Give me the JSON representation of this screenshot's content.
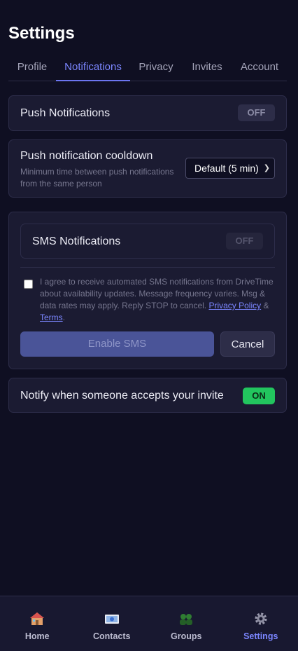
{
  "page": {
    "title": "Settings"
  },
  "tabs": [
    {
      "label": "Profile",
      "active": false
    },
    {
      "label": "Notifications",
      "active": true
    },
    {
      "label": "Privacy",
      "active": false
    },
    {
      "label": "Invites",
      "active": false
    },
    {
      "label": "Account",
      "active": false
    }
  ],
  "push": {
    "label": "Push Notifications",
    "state": "OFF"
  },
  "cooldown": {
    "label": "Push notification cooldown",
    "description_line1": "Minimum time between push notifications",
    "description_line2": "from the same person",
    "selected": "Default (5 min)"
  },
  "sms": {
    "label": "SMS Notifications",
    "state": "OFF",
    "consent_line1": "I agree to receive automated SMS notifications from DriveTime",
    "consent_line2": "about availability updates. Message frequency varies. Msg &",
    "consent_line3_prefix": "data rates may apply. Reply STOP to cancel. ",
    "privacy_link": "Privacy Policy",
    "amp": " &",
    "terms_link": "Terms",
    "period": ".",
    "enable_button": "Enable SMS",
    "cancel_button": "Cancel"
  },
  "invite_notify": {
    "label": "Notify when someone accepts your invite",
    "state": "ON"
  },
  "nav": {
    "home": "Home",
    "contacts": "Contacts",
    "groups": "Groups",
    "settings": "Settings",
    "active": "settings"
  },
  "colors": {
    "background": "#0f0f22",
    "card": "#1b1b32",
    "accent": "#7b86ff",
    "on_green": "#22c55e"
  }
}
